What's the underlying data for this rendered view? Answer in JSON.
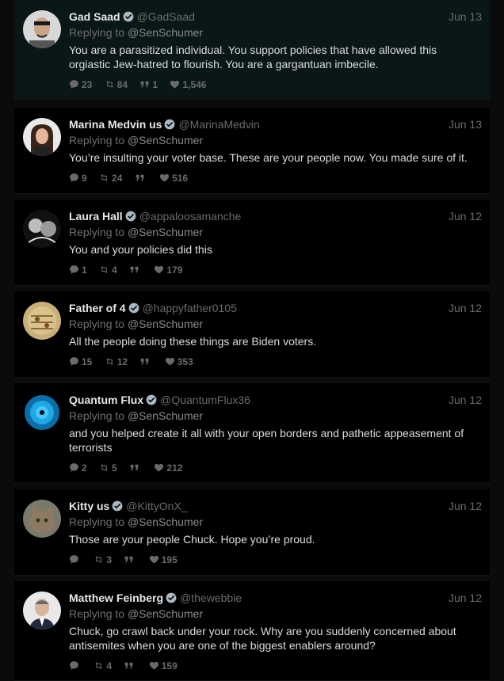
{
  "top_mark": "[][]",
  "reply_prefix": "Replying to",
  "tweets": [
    {
      "name": "Gad Saad",
      "handle": "@GadSaad",
      "date": "Jun 13",
      "reply_to": "@SenSchumer",
      "text": "You are a parasitized individual.  You support policies that have allowed this orgiastic Jew-hatred to flourish.  You are a gargantuan imbecile.",
      "replies": "23",
      "retweets": "84",
      "quotes": "1",
      "likes": "1,546"
    },
    {
      "name": "Marina Medvin us",
      "handle": "@MarinaMedvin",
      "date": "Jun 13",
      "reply_to": "@SenSchumer",
      "text": "You’re insulting your voter base. These are your people now. You made sure of it.",
      "replies": "9",
      "retweets": "24",
      "quotes": "",
      "likes": "516"
    },
    {
      "name": "Laura Hall",
      "handle": "@appaloosamanche",
      "date": "Jun 12",
      "reply_to": "@SenSchumer",
      "text": "You and your policies did this",
      "replies": "1",
      "retweets": "4",
      "quotes": "",
      "likes": "179"
    },
    {
      "name": "Father of 4",
      "handle": "@happyfather0105",
      "date": "Jun 12",
      "reply_to": "@SenSchumer",
      "text": "All the people doing these things are Biden voters.",
      "replies": "15",
      "retweets": "12",
      "quotes": "",
      "likes": "353"
    },
    {
      "name": "Quantum Flux",
      "handle": "@QuantumFlux36",
      "date": "Jun 12",
      "reply_to": "@SenSchumer",
      "text": "and you helped create it all with your open borders and pathetic appeasement of terrorists",
      "replies": "2",
      "retweets": "5",
      "quotes": "",
      "likes": "212"
    },
    {
      "name": "Kitty us",
      "handle": "@KittyOnX_",
      "date": "Jun 12",
      "reply_to": "@SenSchumer",
      "text": "Those are your people Chuck. Hope you’re proud.",
      "replies": "",
      "retweets": "3",
      "quotes": "",
      "likes": "195"
    },
    {
      "name": "Matthew Feinberg",
      "handle": "@thewebbie",
      "date": "Jun 12",
      "reply_to": "@SenSchumer",
      "text": "Chuck, go crawl back under your rock. Why are you suddenly concerned about antisemites when you are one of the biggest enablers around?",
      "replies": "",
      "retweets": "4",
      "quotes": "",
      "likes": "159"
    }
  ],
  "colors": {
    "background": "#0b0b0b",
    "card": "#000000",
    "highlight": "#091717",
    "verified": "#aab8c2",
    "muted": "#6a6a6a"
  },
  "icons": [
    "reply-icon",
    "retweet-icon",
    "quote-icon",
    "like-icon",
    "verified-icon"
  ]
}
